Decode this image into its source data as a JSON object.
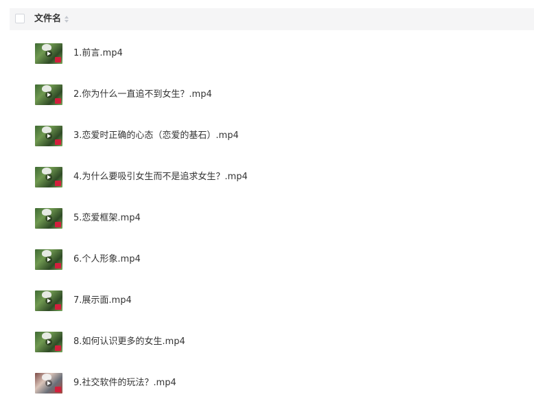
{
  "header": {
    "column_label": "文件名"
  },
  "files": [
    {
      "name": "1.前言.mp4"
    },
    {
      "name": "2.你为什么一直追不到女生？.mp4"
    },
    {
      "name": "3.恋爱时正确的心态（恋爱的基石）.mp4"
    },
    {
      "name": "4.为什么要吸引女生而不是追求女生？.mp4"
    },
    {
      "name": "5.恋爱框架.mp4"
    },
    {
      "name": "6.个人形象.mp4"
    },
    {
      "name": "7.展示面.mp4"
    },
    {
      "name": "8.如何认识更多的女生.mp4"
    },
    {
      "name": "9.社交软件的玩法？.mp4"
    }
  ],
  "icons": {
    "header_checkbox": "checkbox-icon",
    "sort": "sort-icon",
    "thumbnail_overlay": "play-icon"
  },
  "colors": {
    "header_bg": "#f5f5f6",
    "text": "#333333",
    "thumb_tag": "#d21f3c"
  }
}
